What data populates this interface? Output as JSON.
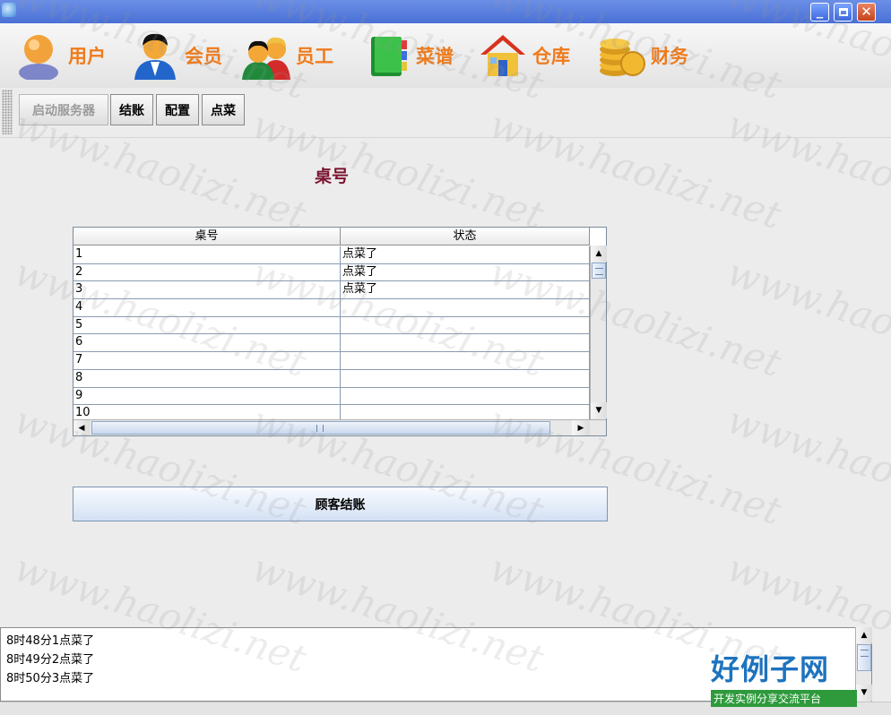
{
  "menu": {
    "items": [
      {
        "label": "用户",
        "icon": "user-icon"
      },
      {
        "label": "会员",
        "icon": "member-icon"
      },
      {
        "label": "员工",
        "icon": "staff-icon"
      },
      {
        "label": "菜谱",
        "icon": "book-icon"
      },
      {
        "label": "仓库",
        "icon": "house-icon"
      },
      {
        "label": "财务",
        "icon": "coins-icon"
      }
    ]
  },
  "toolbar": {
    "start_server": "启动服务器",
    "checkout": "结账",
    "config": "配置",
    "order": "点菜"
  },
  "main": {
    "title": "桌号",
    "table": {
      "columns": [
        "桌号",
        "状态"
      ],
      "rows": [
        [
          "1",
          "点菜了"
        ],
        [
          "2",
          "点菜了"
        ],
        [
          "3",
          "点菜了"
        ],
        [
          "4",
          ""
        ],
        [
          "5",
          ""
        ],
        [
          "6",
          ""
        ],
        [
          "7",
          ""
        ],
        [
          "8",
          ""
        ],
        [
          "9",
          ""
        ],
        [
          "10",
          ""
        ]
      ]
    },
    "checkout_button": "顾客结账"
  },
  "log": {
    "lines": [
      "8时48分1点菜了",
      "8时49分2点菜了",
      "8时50分3点菜了"
    ]
  },
  "watermark": {
    "text": "www.haolizi.net"
  },
  "logo": {
    "title": "好例子网",
    "subtitle": "开发实例分享交流平台"
  },
  "colors": {
    "menu_label": "#ef7b1c",
    "title": "#7a1430",
    "titlebar": "#4a70d6"
  }
}
